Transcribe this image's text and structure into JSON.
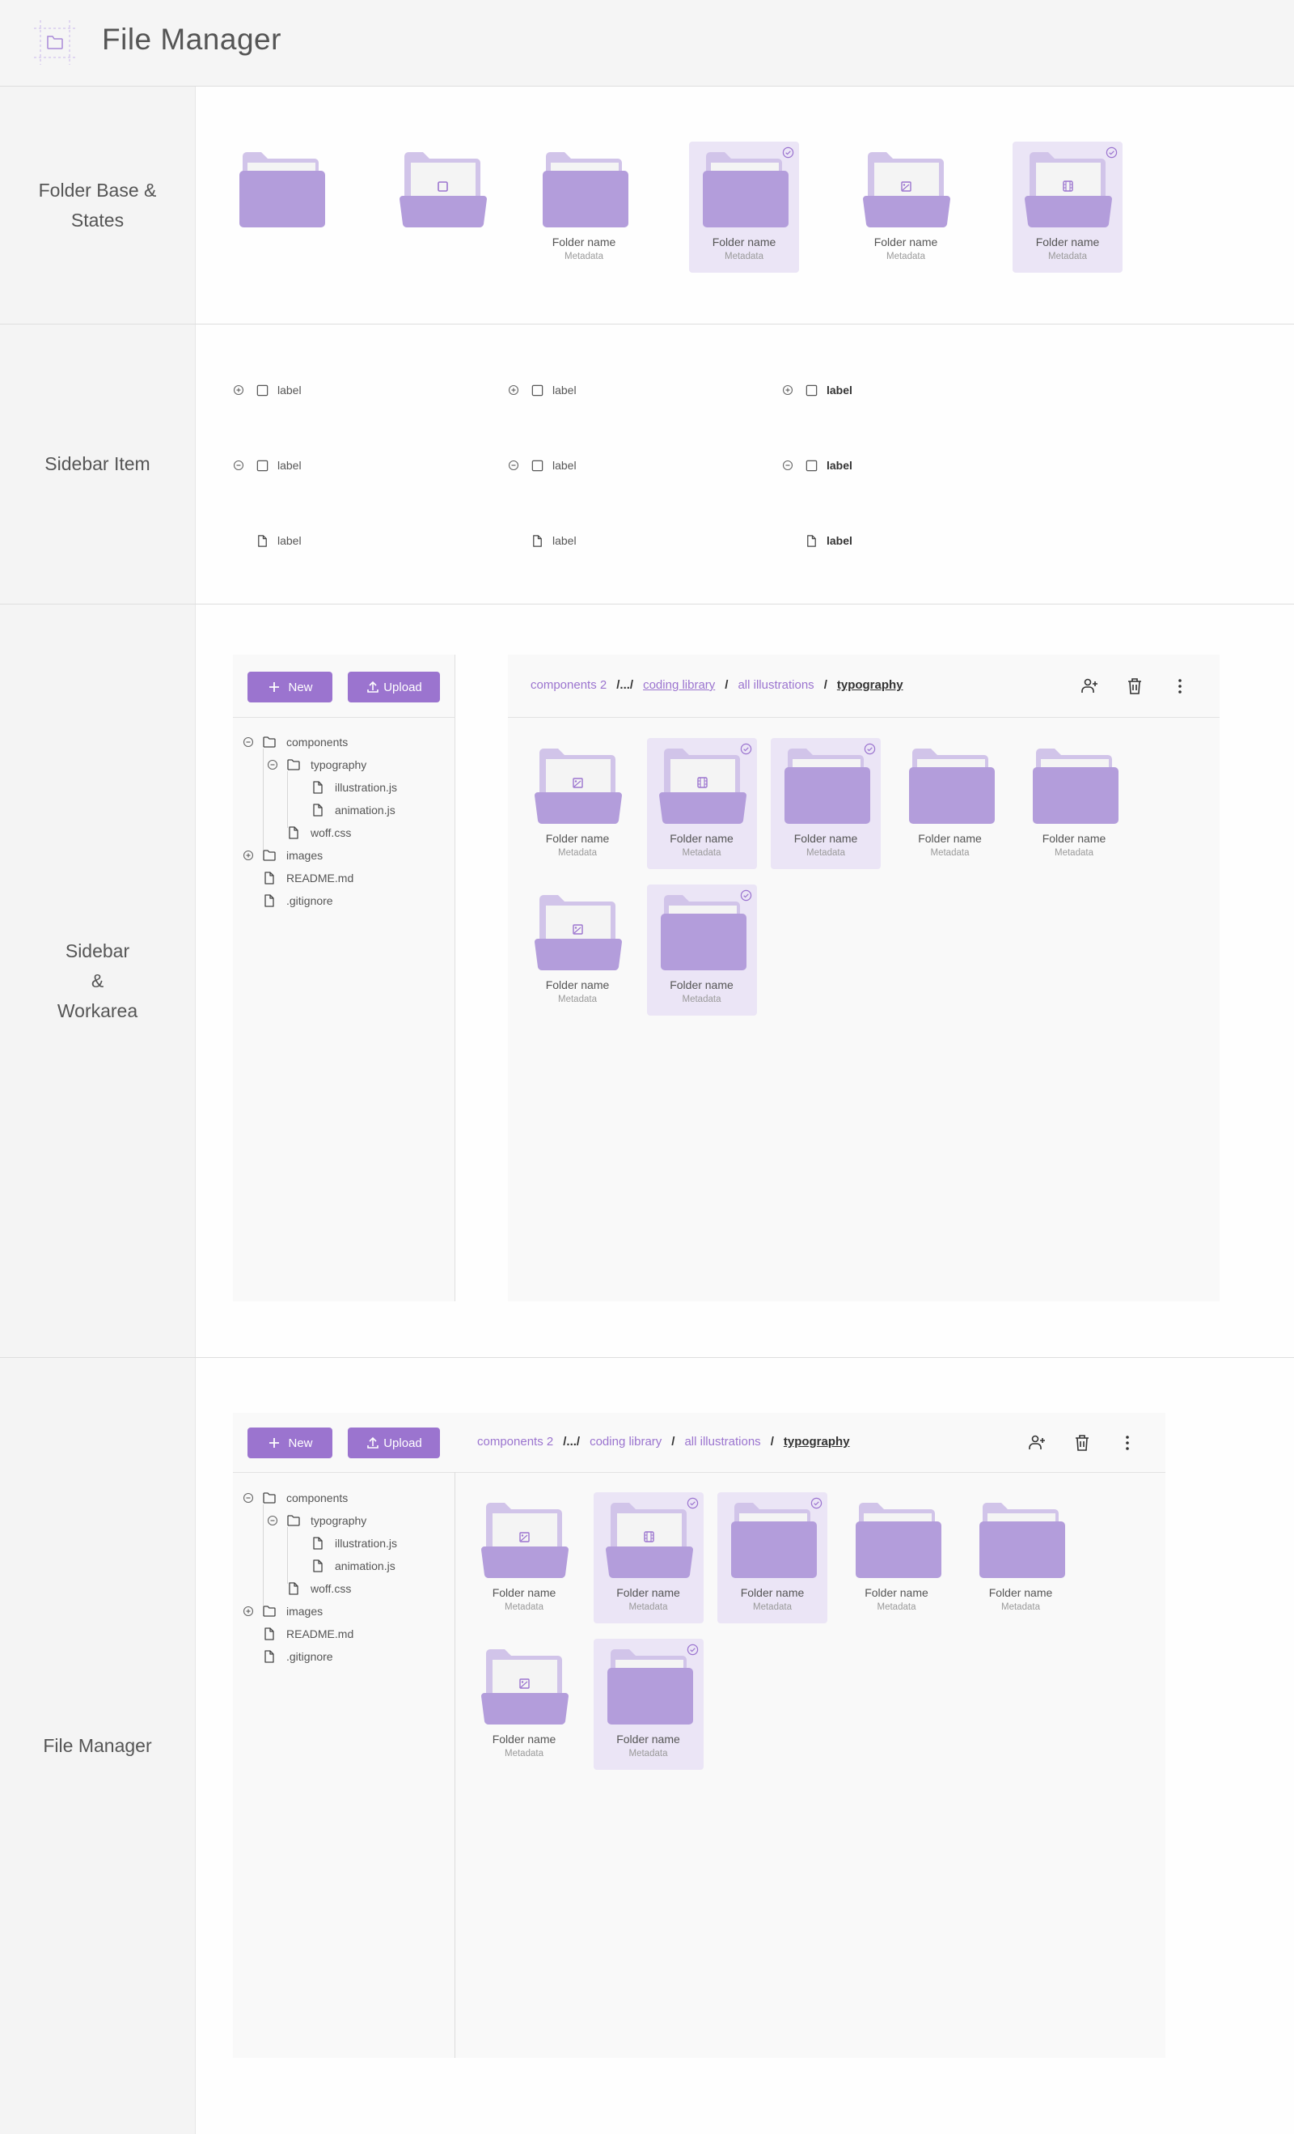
{
  "header": {
    "title": "File Manager",
    "logo_icon": "folder-icon"
  },
  "colors": {
    "accent": "#9b74cf",
    "folder_front": "#b39ddb",
    "folder_back": "#d1c4e9",
    "selected_bg": "#ebe5f6",
    "paper": "#f4f4f4"
  },
  "sections": {
    "folder_states": {
      "label": "Folder Base &\nStates",
      "cards": [
        {
          "variant": "closed",
          "selected": false,
          "name": "",
          "meta": ""
        },
        {
          "variant": "open-square",
          "selected": false,
          "name": "",
          "meta": ""
        },
        {
          "variant": "closed",
          "selected": false,
          "name": "Folder name",
          "meta": "Metadata"
        },
        {
          "variant": "closed",
          "selected": true,
          "name": "Folder name",
          "meta": "Metadata"
        },
        {
          "variant": "open-image",
          "selected": false,
          "name": "Folder name",
          "meta": "Metadata"
        },
        {
          "variant": "open-video",
          "selected": true,
          "name": "Folder name",
          "meta": "Metadata"
        }
      ]
    },
    "sidebar_item": {
      "label": "Sidebar Item",
      "columns": [
        {
          "weight": "normal",
          "rows": [
            {
              "toggle": "expand",
              "icon": "folder",
              "label": "label"
            },
            {
              "toggle": "collapse",
              "icon": "folder",
              "label": "label"
            },
            {
              "toggle": "none",
              "icon": "file",
              "label": "label"
            }
          ]
        },
        {
          "weight": "normal",
          "rows": [
            {
              "toggle": "expand",
              "icon": "folder",
              "label": "label"
            },
            {
              "toggle": "collapse",
              "icon": "folder",
              "label": "label"
            },
            {
              "toggle": "none",
              "icon": "file",
              "label": "label"
            }
          ]
        },
        {
          "weight": "bold",
          "rows": [
            {
              "toggle": "expand",
              "icon": "folder",
              "label": "label"
            },
            {
              "toggle": "collapse",
              "icon": "folder",
              "label": "label"
            },
            {
              "toggle": "none",
              "icon": "file",
              "label": "label"
            }
          ]
        }
      ]
    },
    "sidebar_workarea": {
      "label": "Sidebar\n&\nWorkarea"
    },
    "file_manager": {
      "label": "File Manager"
    }
  },
  "toolbar": {
    "new_label": "New",
    "upload_label": "Upload"
  },
  "breadcrumb": {
    "items": [
      "components 2",
      "coding library",
      "all illustrations"
    ],
    "ellipsis": "/.../",
    "separator": "/",
    "current": "typography"
  },
  "actions": {
    "add_user": "add-user-icon",
    "delete": "trash-icon",
    "more": "more-vertical-icon"
  },
  "tree": [
    {
      "depth": 0,
      "toggle": "collapse",
      "icon": "folder",
      "label": "components"
    },
    {
      "depth": 1,
      "toggle": "collapse",
      "icon": "folder",
      "label": "typography"
    },
    {
      "depth": 2,
      "toggle": "none",
      "icon": "file",
      "label": "illustration.js"
    },
    {
      "depth": 2,
      "toggle": "none",
      "icon": "file",
      "label": "animation.js"
    },
    {
      "depth": 1,
      "toggle": "none",
      "icon": "file",
      "label": "woff.css"
    },
    {
      "depth": 0,
      "toggle": "expand",
      "icon": "folder",
      "label": "images"
    },
    {
      "depth": 0,
      "toggle": "none",
      "icon": "file",
      "label": "README.md"
    },
    {
      "depth": 0,
      "toggle": "none",
      "icon": "file",
      "label": ".gitignore"
    }
  ],
  "grid": [
    {
      "variant": "open-image",
      "selected": false,
      "name": "Folder name",
      "meta": "Metadata"
    },
    {
      "variant": "open-video",
      "selected": true,
      "name": "Folder name",
      "meta": "Metadata"
    },
    {
      "variant": "closed",
      "selected": true,
      "name": "Folder name",
      "meta": "Metadata"
    },
    {
      "variant": "closed",
      "selected": false,
      "name": "Folder name",
      "meta": "Metadata"
    },
    {
      "variant": "closed",
      "selected": false,
      "name": "Folder name",
      "meta": "Metadata"
    },
    {
      "variant": "open-image",
      "selected": false,
      "name": "Folder name",
      "meta": "Metadata"
    },
    {
      "variant": "closed",
      "selected": true,
      "name": "Folder name",
      "meta": "Metadata"
    }
  ]
}
